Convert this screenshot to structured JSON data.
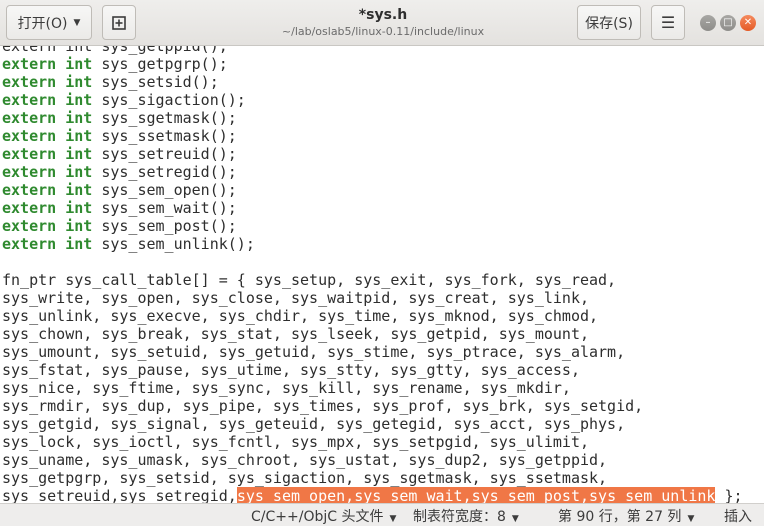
{
  "header": {
    "open_label": "打开(O)",
    "save_label": "保存(S)",
    "title": "*sys.h",
    "path": "~/lab/oslab5/linux-0.11/include/linux"
  },
  "editor": {
    "lines": [
      [
        {
          "t": "extern int sys_getppid();"
        }
      ],
      [
        {
          "t": "extern",
          "kw": true
        },
        {
          "t": " "
        },
        {
          "t": "int",
          "kw": true
        },
        {
          "t": " sys_getpgrp();"
        }
      ],
      [
        {
          "t": "extern",
          "kw": true
        },
        {
          "t": " "
        },
        {
          "t": "int",
          "kw": true
        },
        {
          "t": " sys_setsid();"
        }
      ],
      [
        {
          "t": "extern",
          "kw": true
        },
        {
          "t": " "
        },
        {
          "t": "int",
          "kw": true
        },
        {
          "t": " sys_sigaction();"
        }
      ],
      [
        {
          "t": "extern",
          "kw": true
        },
        {
          "t": " "
        },
        {
          "t": "int",
          "kw": true
        },
        {
          "t": " sys_sgetmask();"
        }
      ],
      [
        {
          "t": "extern",
          "kw": true
        },
        {
          "t": " "
        },
        {
          "t": "int",
          "kw": true
        },
        {
          "t": " sys_ssetmask();"
        }
      ],
      [
        {
          "t": "extern",
          "kw": true
        },
        {
          "t": " "
        },
        {
          "t": "int",
          "kw": true
        },
        {
          "t": " sys_setreuid();"
        }
      ],
      [
        {
          "t": "extern",
          "kw": true
        },
        {
          "t": " "
        },
        {
          "t": "int",
          "kw": true
        },
        {
          "t": " sys_setregid();"
        }
      ],
      [
        {
          "t": "extern",
          "kw": true
        },
        {
          "t": " "
        },
        {
          "t": "int",
          "kw": true
        },
        {
          "t": " sys_sem_open();"
        }
      ],
      [
        {
          "t": "extern",
          "kw": true
        },
        {
          "t": " "
        },
        {
          "t": "int",
          "kw": true
        },
        {
          "t": " sys_sem_wait();"
        }
      ],
      [
        {
          "t": "extern",
          "kw": true
        },
        {
          "t": " "
        },
        {
          "t": "int",
          "kw": true
        },
        {
          "t": " sys_sem_post();"
        }
      ],
      [
        {
          "t": "extern",
          "kw": true
        },
        {
          "t": " "
        },
        {
          "t": "int",
          "kw": true
        },
        {
          "t": " sys_sem_unlink();"
        }
      ],
      [
        {
          "t": ""
        }
      ],
      [
        {
          "t": "fn_ptr sys_call_table[] = { sys_setup, sys_exit, sys_fork, sys_read,"
        }
      ],
      [
        {
          "t": "sys_write, sys_open, sys_close, sys_waitpid, sys_creat, sys_link,"
        }
      ],
      [
        {
          "t": "sys_unlink, sys_execve, sys_chdir, sys_time, sys_mknod, sys_chmod,"
        }
      ],
      [
        {
          "t": "sys_chown, sys_break, sys_stat, sys_lseek, sys_getpid, sys_mount,"
        }
      ],
      [
        {
          "t": "sys_umount, sys_setuid, sys_getuid, sys_stime, sys_ptrace, sys_alarm,"
        }
      ],
      [
        {
          "t": "sys_fstat, sys_pause, sys_utime, sys_stty, sys_gtty, sys_access,"
        }
      ],
      [
        {
          "t": "sys_nice, sys_ftime, sys_sync, sys_kill, sys_rename, sys_mkdir,"
        }
      ],
      [
        {
          "t": "sys_rmdir, sys_dup, sys_pipe, sys_times, sys_prof, sys_brk, sys_setgid,"
        }
      ],
      [
        {
          "t": "sys_getgid, sys_signal, sys_geteuid, sys_getegid, sys_acct, sys_phys,"
        }
      ],
      [
        {
          "t": "sys_lock, sys_ioctl, sys_fcntl, sys_mpx, sys_setpgid, sys_ulimit,"
        }
      ],
      [
        {
          "t": "sys_uname, sys_umask, sys_chroot, sys_ustat, sys_dup2, sys_getppid,"
        }
      ],
      [
        {
          "t": "sys_getpgrp, sys_setsid, sys_sigaction, sys_sgetmask, sys_ssetmask,"
        }
      ],
      [
        {
          "t": "sys_setreuid,sys_setregid,"
        },
        {
          "t": "sys_sem_open,sys_sem_wait,sys_sem_post,sys_sem_unlink",
          "sel": true
        },
        {
          "t": " };"
        }
      ]
    ]
  },
  "status": {
    "language": "C/C++/ObjC 头文件",
    "tab_width": "制表符宽度：8",
    "position": "第 90 行，第 27 列",
    "mode": "插入"
  },
  "colors": {
    "keyword": "#2f8a2f",
    "selection": "#f07746",
    "close_button": "#e45a26"
  }
}
